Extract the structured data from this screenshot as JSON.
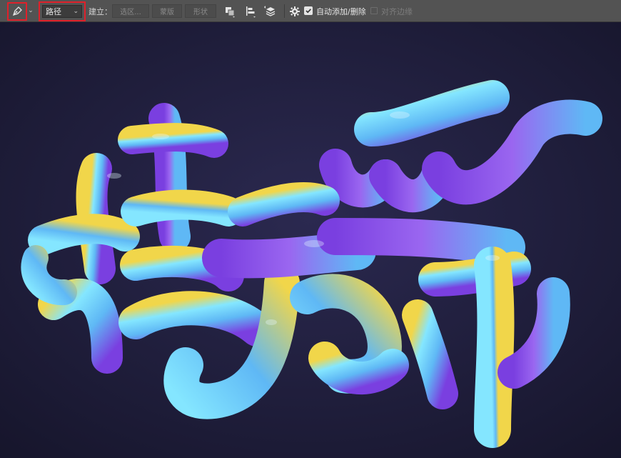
{
  "toolbar": {
    "tool": {
      "icon": "pen-tool-icon"
    },
    "mode_select": {
      "value": "路径"
    },
    "make_label": "建立：",
    "make_buttons": [
      {
        "label": "选区..."
      },
      {
        "label": "蒙版"
      },
      {
        "label": "形状"
      }
    ],
    "icons": [
      "path-operations-icon",
      "path-alignment-icon",
      "path-arrangement-icon",
      "gear-icon"
    ],
    "auto_add_delete": {
      "label": "自动添加/删除",
      "checked": true
    },
    "align_edges": {
      "label": "对齐边缘",
      "checked": false
    }
  },
  "canvas": {
    "artwork": "3d-balloon-lettering",
    "colors": {
      "background": "#1b1a33",
      "purple": "#7a3fe0",
      "blue": "#5fb8f5",
      "cyan": "#84e6ff",
      "yellow": "#f1d64a",
      "highlight": "#e6f7ff"
    }
  },
  "annotations": {
    "highlight_color": "#e0202a"
  }
}
